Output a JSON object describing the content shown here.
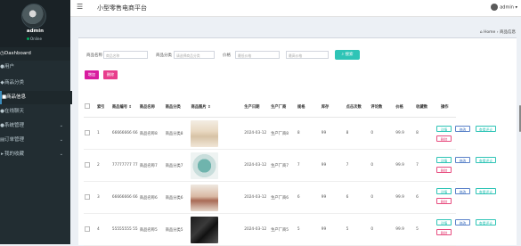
{
  "sidebar": {
    "user": {
      "name": "admin",
      "status": "Online"
    },
    "items": [
      {
        "label": "Dashboard",
        "icon": "dashboard-icon",
        "has_caret": false
      },
      {
        "label": "用户",
        "icon": "user-icon",
        "has_caret": false
      },
      {
        "label": "商品分类",
        "icon": "tags-icon",
        "has_caret": false
      },
      {
        "label": "商品信息",
        "icon": "box-icon",
        "has_caret": false
      },
      {
        "label": "在线聊天",
        "icon": "chat-icon",
        "has_caret": false
      },
      {
        "label": "系统管理",
        "icon": "settings-icon",
        "has_caret": true
      },
      {
        "label": "订单管理",
        "icon": "order-icon",
        "has_caret": true
      },
      {
        "label": "我的收藏",
        "icon": "star-icon",
        "has_caret": true
      }
    ]
  },
  "topbar": {
    "title": "小型零售电商平台",
    "user": "admin"
  },
  "breadcrumb": {
    "home": "Home",
    "current": "商品信息"
  },
  "filters": {
    "name_label": "商品名称",
    "name_placeholder": "商品名称",
    "category_label": "商品分类",
    "category_placeholder": "请选择商品分类",
    "price_label": "价格",
    "price_min_placeholder": "最低价格",
    "price_max_placeholder": "最高价格",
    "search_label": "搜索"
  },
  "actions": {
    "add": "增加",
    "delete": "删除"
  },
  "table": {
    "columns": [
      "",
      "索引",
      "商品编号",
      "商品名称",
      "商品分类",
      "商品图片",
      "",
      "生产日期",
      "生产厂商",
      "规格",
      "库存",
      "点击次数",
      "评论数",
      "价格",
      "收藏数",
      "操作"
    ],
    "rows": [
      {
        "index": "1",
        "code": "66666666 66",
        "name": "商品名称8",
        "category": "商品分类8",
        "image": "tea-set",
        "date": "2024-03-12",
        "maker": "生产厂商8",
        "spec": "8",
        "stock": "99",
        "clicks": "8",
        "comments": "0",
        "price": "99.9",
        "favorites": "8"
      },
      {
        "index": "2",
        "code": "77777777 77",
        "name": "商品名称7",
        "category": "商品分类7",
        "image": "green-gift",
        "date": "2024-03-12",
        "maker": "生产厂商7",
        "spec": "7",
        "stock": "99",
        "clicks": "7",
        "comments": "0",
        "price": "99.9",
        "favorites": "7"
      },
      {
        "index": "3",
        "code": "66666666 66",
        "name": "商品名称6",
        "category": "商品分类6",
        "image": "tea-cups",
        "date": "2024-03-12",
        "maker": "生产厂商6",
        "spec": "6",
        "stock": "99",
        "clicks": "6",
        "comments": "0",
        "price": "99.9",
        "favorites": "6"
      },
      {
        "index": "4",
        "code": "55555555 55",
        "name": "商品名称5",
        "category": "商品分类5",
        "image": "black-tube",
        "date": "2024-03-12",
        "maker": "生产厂商5",
        "spec": "5",
        "stock": "99",
        "clicks": "5",
        "comments": "0",
        "price": "99.9",
        "favorites": "5"
      }
    ],
    "row_actions": {
      "detail": "详情",
      "edit": "修改",
      "review": "查看评论",
      "delete": "删除"
    }
  },
  "colors": {
    "sidebar": "#222d32",
    "accent": "#2ec4b6",
    "pink": "#d81b9f"
  }
}
